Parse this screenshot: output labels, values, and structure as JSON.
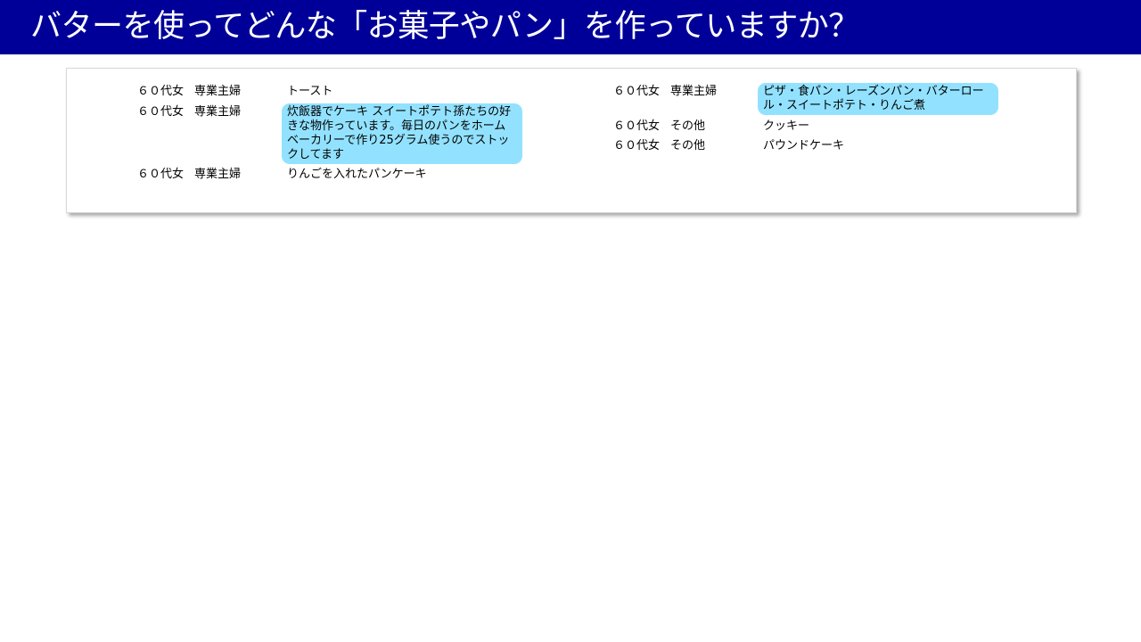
{
  "header": {
    "title": "バターを使ってどんな「お菓子やパン」を作っていますか？"
  },
  "colors": {
    "title_bar": "#000099",
    "highlight": "#92e2ff"
  },
  "left_column": [
    {
      "age": "６０代女",
      "occupation": "専業主婦",
      "answer": "トースト",
      "highlighted": false
    },
    {
      "age": "６０代女",
      "occupation": "専業主婦",
      "answer": "炊飯器でケーキ スイートポテト孫たちの好きな物作っています。毎日のパンをホームベーカリーで作り25グラム使うのでストックしてます",
      "highlighted": true
    },
    {
      "age": "６０代女",
      "occupation": "専業主婦",
      "answer": "りんごを入れたパンケーキ",
      "highlighted": false
    }
  ],
  "right_column": [
    {
      "age": "６０代女",
      "occupation": "専業主婦",
      "answer": "ピザ・食パン・レーズンパン・バターロール・スイートポテト・りんご煮",
      "highlighted": true
    },
    {
      "age": "６０代女",
      "occupation": "その他",
      "answer": "クッキー",
      "highlighted": false
    },
    {
      "age": "６０代女",
      "occupation": "その他",
      "answer": "パウンドケーキ",
      "highlighted": false
    }
  ]
}
